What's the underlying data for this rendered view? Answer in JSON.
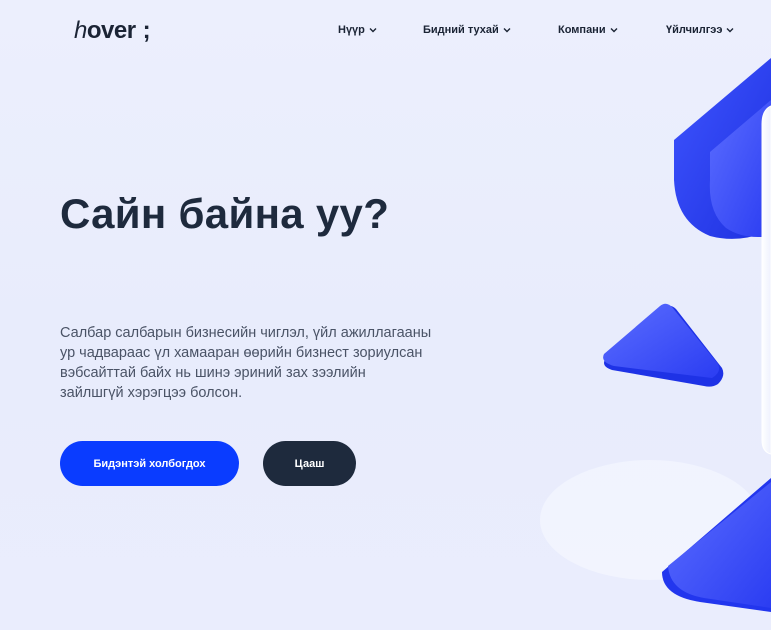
{
  "logo": {
    "first_letter": "h",
    "rest": "over",
    "semicolon": ";"
  },
  "nav": {
    "items": [
      {
        "label": "Нүүр"
      },
      {
        "label": "Бидний тухай"
      },
      {
        "label": "Компани"
      },
      {
        "label": "Үйлчилгээ"
      }
    ]
  },
  "hero": {
    "title": "Сайн байна уу?",
    "description": "Салбар салбарын бизнесийн чиглэл, үйл ажиллагааны ур чадвараас үл хамааран өөрийн бизнест зориулсан вэбсайттай байх нь шинэ эриний зах зээлийн зайлшгүй хэрэгцээ болсон.",
    "primary_button": "Бидэнтэй холбогдох",
    "secondary_button": "Цааш"
  },
  "colors": {
    "accent": "#0a3cff",
    "dark": "#1e2a3d",
    "background": "#eceffd"
  }
}
